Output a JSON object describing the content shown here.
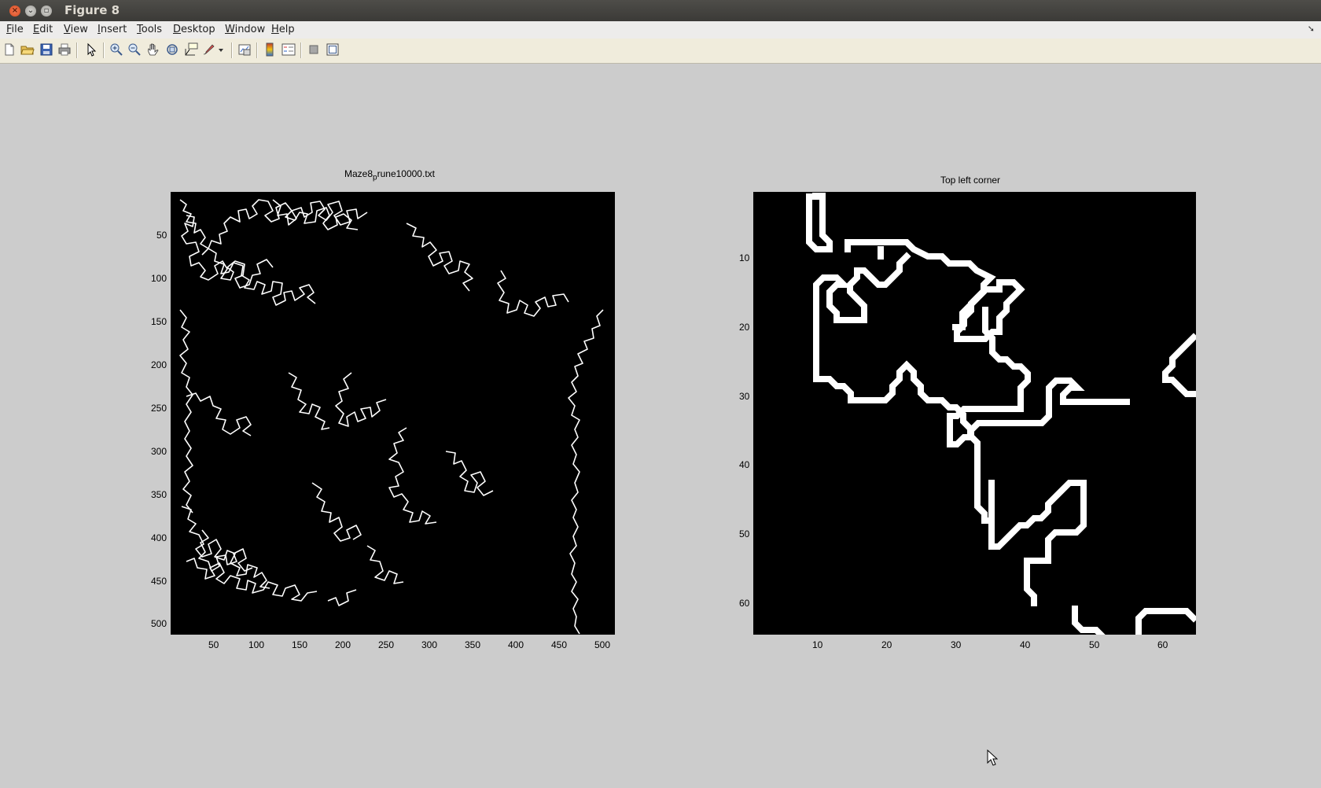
{
  "window": {
    "title": "Figure 8"
  },
  "menu": [
    "File",
    "Edit",
    "View",
    "Insert",
    "Tools",
    "Desktop",
    "Window",
    "Help"
  ],
  "menu_end_icon": "dock-arrow-icon",
  "toolbar": {
    "buttons": [
      "new-figure-icon",
      "open-file-icon",
      "save-icon",
      "print-icon",
      "edit-plot-icon",
      "zoom-in-icon",
      "zoom-out-icon",
      "pan-icon",
      "rotate-3d-icon",
      "data-cursor-icon",
      "brush-icon",
      "brush-dropdown-icon",
      "link-plot-icon",
      "insert-colorbar-icon",
      "insert-legend-icon",
      "hide-plot-tools-icon",
      "show-plot-tools-icon"
    ]
  },
  "left_axes": {
    "title_main": "Maze8",
    "title_sub": "p",
    "title_rest": "rune10000.txt",
    "xticks": [
      "50",
      "100",
      "150",
      "200",
      "250",
      "300",
      "350",
      "400",
      "450",
      "500"
    ],
    "yticks": [
      "50",
      "100",
      "150",
      "200",
      "250",
      "300",
      "350",
      "400",
      "450",
      "500"
    ]
  },
  "right_axes": {
    "title": "Top left corner",
    "xticks": [
      "10",
      "20",
      "30",
      "40",
      "50",
      "60"
    ],
    "yticks": [
      "10",
      "20",
      "30",
      "40",
      "50",
      "60"
    ]
  }
}
